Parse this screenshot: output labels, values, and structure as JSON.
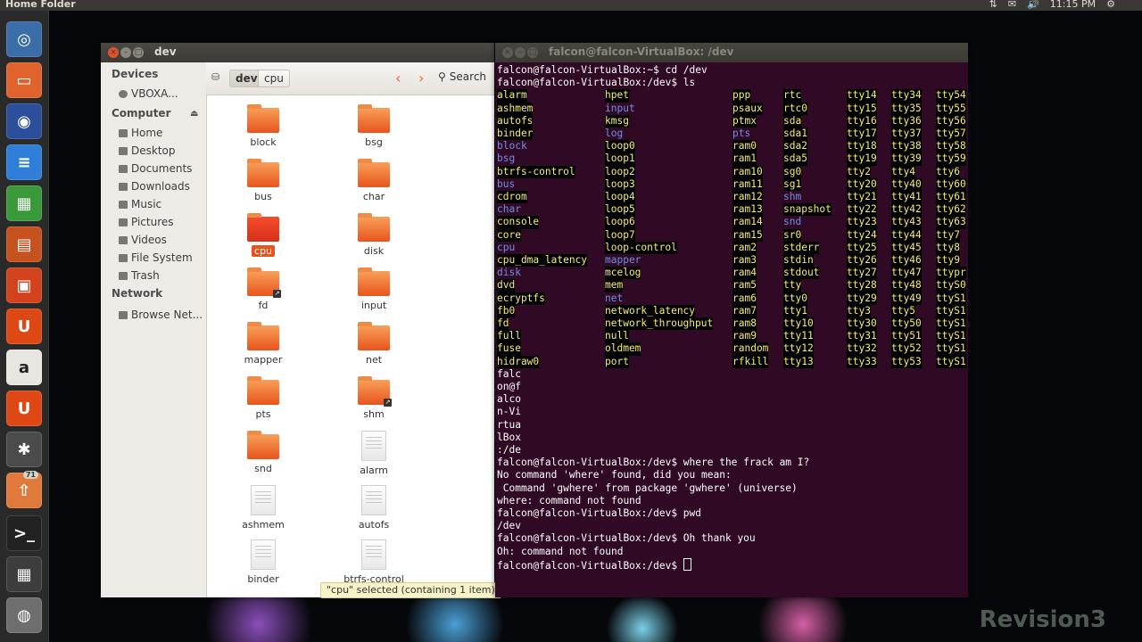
{
  "top_panel": {
    "title": "Home Folder",
    "time": "11:15 PM"
  },
  "launcher": {
    "badge_count": "71"
  },
  "nautilus": {
    "window_title": "dev",
    "sidebar": {
      "devices_heading": "Devices",
      "devices": [
        "VBOXA..."
      ],
      "computer_heading": "Computer",
      "computer_items": [
        "Home",
        "Desktop",
        "Documents",
        "Downloads",
        "Music",
        "Pictures",
        "Videos",
        "File System",
        "Trash"
      ],
      "network_heading": "Network",
      "network_items": [
        "Browse Net..."
      ]
    },
    "breadcrumbs": [
      "dev",
      "cpu"
    ],
    "search_label": "Search",
    "files": [
      {
        "name": "block",
        "type": "folder"
      },
      {
        "name": "bsg",
        "type": "folder"
      },
      {
        "name": "bus",
        "type": "folder"
      },
      {
        "name": "char",
        "type": "folder"
      },
      {
        "name": "cpu",
        "type": "folder",
        "selected": true
      },
      {
        "name": "disk",
        "type": "folder"
      },
      {
        "name": "fd",
        "type": "folder-link"
      },
      {
        "name": "input",
        "type": "folder"
      },
      {
        "name": "mapper",
        "type": "folder"
      },
      {
        "name": "net",
        "type": "folder"
      },
      {
        "name": "pts",
        "type": "folder"
      },
      {
        "name": "shm",
        "type": "folder-link"
      },
      {
        "name": "snd",
        "type": "folder"
      },
      {
        "name": "alarm",
        "type": "file"
      },
      {
        "name": "ashmem",
        "type": "file"
      },
      {
        "name": "autofs",
        "type": "file"
      },
      {
        "name": "binder",
        "type": "file"
      },
      {
        "name": "btrfs-control",
        "type": "file"
      }
    ],
    "status": "\"cpu\" selected (containing 1 item)"
  },
  "terminal": {
    "window_title": "falcon@falcon-VirtualBox: /dev",
    "head_lines": [
      "falcon@falcon-VirtualBox:~$ cd /dev",
      "falcon@falcon-VirtualBox:/dev$ ls"
    ],
    "ls_columns": [
      [
        {
          "t": "alarm",
          "s": "y"
        },
        {
          "t": "ashmem",
          "s": "y"
        },
        {
          "t": "autofs",
          "s": "y"
        },
        {
          "t": "binder",
          "s": "y"
        },
        {
          "t": "block",
          "s": "b"
        },
        {
          "t": "bsg",
          "s": "b"
        },
        {
          "t": "btrfs-control",
          "s": "y"
        },
        {
          "t": "bus",
          "s": "b"
        },
        {
          "t": "cdrom",
          "s": "y"
        },
        {
          "t": "char",
          "s": "b"
        },
        {
          "t": "console",
          "s": "y"
        },
        {
          "t": "core",
          "s": "y"
        },
        {
          "t": "cpu",
          "s": "b"
        },
        {
          "t": "cpu_dma_latency",
          "s": "y"
        },
        {
          "t": "disk",
          "s": "b"
        },
        {
          "t": "dvd",
          "s": "y"
        },
        {
          "t": "ecryptfs",
          "s": "y"
        },
        {
          "t": "fb0",
          "s": "y"
        },
        {
          "t": "fd",
          "s": "y"
        },
        {
          "t": "full",
          "s": "y"
        },
        {
          "t": "fuse",
          "s": "y"
        },
        {
          "t": "hidraw0",
          "s": "y"
        }
      ],
      [
        {
          "t": "hpet",
          "s": "y"
        },
        {
          "t": "input",
          "s": "b"
        },
        {
          "t": "kmsg",
          "s": "y"
        },
        {
          "t": "log",
          "s": "b"
        },
        {
          "t": "loop0",
          "s": "y"
        },
        {
          "t": "loop1",
          "s": "y"
        },
        {
          "t": "loop2",
          "s": "y"
        },
        {
          "t": "loop3",
          "s": "y"
        },
        {
          "t": "loop4",
          "s": "y"
        },
        {
          "t": "loop5",
          "s": "y"
        },
        {
          "t": "loop6",
          "s": "y"
        },
        {
          "t": "loop7",
          "s": "y"
        },
        {
          "t": "loop-control",
          "s": "y"
        },
        {
          "t": "mapper",
          "s": "b"
        },
        {
          "t": "mcelog",
          "s": "y"
        },
        {
          "t": "mem",
          "s": "y"
        },
        {
          "t": "net",
          "s": "b"
        },
        {
          "t": "network_latency",
          "s": "y"
        },
        {
          "t": "network_throughput",
          "s": "y"
        },
        {
          "t": "null",
          "s": "y"
        },
        {
          "t": "oldmem",
          "s": "y"
        },
        {
          "t": "port",
          "s": "y"
        }
      ],
      [
        {
          "t": "ppp",
          "s": "y"
        },
        {
          "t": "psaux",
          "s": "y"
        },
        {
          "t": "ptmx",
          "s": "y"
        },
        {
          "t": "pts",
          "s": "b"
        },
        {
          "t": "ram0",
          "s": "y"
        },
        {
          "t": "ram1",
          "s": "y"
        },
        {
          "t": "ram10",
          "s": "y"
        },
        {
          "t": "ram11",
          "s": "y"
        },
        {
          "t": "ram12",
          "s": "y"
        },
        {
          "t": "ram13",
          "s": "y"
        },
        {
          "t": "ram14",
          "s": "y"
        },
        {
          "t": "ram15",
          "s": "y"
        },
        {
          "t": "ram2",
          "s": "y"
        },
        {
          "t": "ram3",
          "s": "y"
        },
        {
          "t": "ram4",
          "s": "y"
        },
        {
          "t": "ram5",
          "s": "y"
        },
        {
          "t": "ram6",
          "s": "y"
        },
        {
          "t": "ram7",
          "s": "y"
        },
        {
          "t": "ram8",
          "s": "y"
        },
        {
          "t": "ram9",
          "s": "y"
        },
        {
          "t": "random",
          "s": "y"
        },
        {
          "t": "rfkill",
          "s": "y"
        }
      ],
      [
        {
          "t": "rtc",
          "s": "y"
        },
        {
          "t": "rtc0",
          "s": "y"
        },
        {
          "t": "sda",
          "s": "y"
        },
        {
          "t": "sda1",
          "s": "y"
        },
        {
          "t": "sda2",
          "s": "y"
        },
        {
          "t": "sda5",
          "s": "y"
        },
        {
          "t": "sg0",
          "s": "y"
        },
        {
          "t": "sg1",
          "s": "y"
        },
        {
          "t": "shm",
          "s": "b"
        },
        {
          "t": "snapshot",
          "s": "y"
        },
        {
          "t": "snd",
          "s": "b"
        },
        {
          "t": "sr0",
          "s": "y"
        },
        {
          "t": "stderr",
          "s": "y"
        },
        {
          "t": "stdin",
          "s": "y"
        },
        {
          "t": "stdout",
          "s": "y"
        },
        {
          "t": "tty",
          "s": "y"
        },
        {
          "t": "tty0",
          "s": "y"
        },
        {
          "t": "tty1",
          "s": "y"
        },
        {
          "t": "tty10",
          "s": "y"
        },
        {
          "t": "tty11",
          "s": "y"
        },
        {
          "t": "tty12",
          "s": "y"
        },
        {
          "t": "tty13",
          "s": "y"
        }
      ],
      [
        {
          "t": "tty14",
          "s": "y"
        },
        {
          "t": "tty15",
          "s": "y"
        },
        {
          "t": "tty16",
          "s": "y"
        },
        {
          "t": "tty17",
          "s": "y"
        },
        {
          "t": "tty18",
          "s": "y"
        },
        {
          "t": "tty19",
          "s": "y"
        },
        {
          "t": "tty2",
          "s": "y"
        },
        {
          "t": "tty20",
          "s": "y"
        },
        {
          "t": "tty21",
          "s": "y"
        },
        {
          "t": "tty22",
          "s": "y"
        },
        {
          "t": "tty23",
          "s": "y"
        },
        {
          "t": "tty24",
          "s": "y"
        },
        {
          "t": "tty25",
          "s": "y"
        },
        {
          "t": "tty26",
          "s": "y"
        },
        {
          "t": "tty27",
          "s": "y"
        },
        {
          "t": "tty28",
          "s": "y"
        },
        {
          "t": "tty29",
          "s": "y"
        },
        {
          "t": "tty3",
          "s": "y"
        },
        {
          "t": "tty30",
          "s": "y"
        },
        {
          "t": "tty31",
          "s": "y"
        },
        {
          "t": "tty32",
          "s": "y"
        },
        {
          "t": "tty33",
          "s": "y"
        }
      ],
      [
        {
          "t": "tty34",
          "s": "y"
        },
        {
          "t": "tty35",
          "s": "y"
        },
        {
          "t": "tty36",
          "s": "y"
        },
        {
          "t": "tty37",
          "s": "y"
        },
        {
          "t": "tty38",
          "s": "y"
        },
        {
          "t": "tty39",
          "s": "y"
        },
        {
          "t": "tty4",
          "s": "y"
        },
        {
          "t": "tty40",
          "s": "y"
        },
        {
          "t": "tty41",
          "s": "y"
        },
        {
          "t": "tty42",
          "s": "y"
        },
        {
          "t": "tty43",
          "s": "y"
        },
        {
          "t": "tty44",
          "s": "y"
        },
        {
          "t": "tty45",
          "s": "y"
        },
        {
          "t": "tty46",
          "s": "y"
        },
        {
          "t": "tty47",
          "s": "y"
        },
        {
          "t": "tty48",
          "s": "y"
        },
        {
          "t": "tty49",
          "s": "y"
        },
        {
          "t": "tty5",
          "s": "y"
        },
        {
          "t": "tty50",
          "s": "y"
        },
        {
          "t": "tty51",
          "s": "y"
        },
        {
          "t": "tty52",
          "s": "y"
        },
        {
          "t": "tty53",
          "s": "y"
        }
      ],
      [
        {
          "t": "tty54",
          "s": "y"
        },
        {
          "t": "tty55",
          "s": "y"
        },
        {
          "t": "tty56",
          "s": "y"
        },
        {
          "t": "tty57",
          "s": "y"
        },
        {
          "t": "tty58",
          "s": "y"
        },
        {
          "t": "tty59",
          "s": "y"
        },
        {
          "t": "tty6",
          "s": "y"
        },
        {
          "t": "tty60",
          "s": "y"
        },
        {
          "t": "tty61",
          "s": "y"
        },
        {
          "t": "tty62",
          "s": "y"
        },
        {
          "t": "tty63",
          "s": "y"
        },
        {
          "t": "tty7",
          "s": "y"
        },
        {
          "t": "tty8",
          "s": "y"
        },
        {
          "t": "tty9",
          "s": "y"
        },
        {
          "t": "ttypr",
          "s": "y"
        },
        {
          "t": "ttyS0",
          "s": "y"
        },
        {
          "t": "ttyS1",
          "s": "y"
        },
        {
          "t": "ttyS1",
          "s": "y"
        },
        {
          "t": "ttyS1",
          "s": "y"
        },
        {
          "t": "ttyS1",
          "s": "y"
        },
        {
          "t": "ttyS1",
          "s": "y"
        },
        {
          "t": "ttyS1",
          "s": "y"
        }
      ]
    ],
    "wrap_lines": [
      "falc",
      "on@f",
      "alco",
      "n-Vi",
      "rtua",
      "lBox",
      ":/de"
    ],
    "tail_lines": [
      "falcon@falcon-VirtualBox:/dev$ where the frack am I?",
      "No command 'where' found, did you mean:",
      " Command 'gwhere' from package 'gwhere' (universe)",
      "where: command not found",
      "falcon@falcon-VirtualBox:/dev$ pwd",
      "/dev",
      "falcon@falcon-VirtualBox:/dev$ Oh thank you",
      "Oh: command not found"
    ],
    "prompt": "falcon@falcon-VirtualBox:/dev$ "
  },
  "watermark": "Revision3"
}
